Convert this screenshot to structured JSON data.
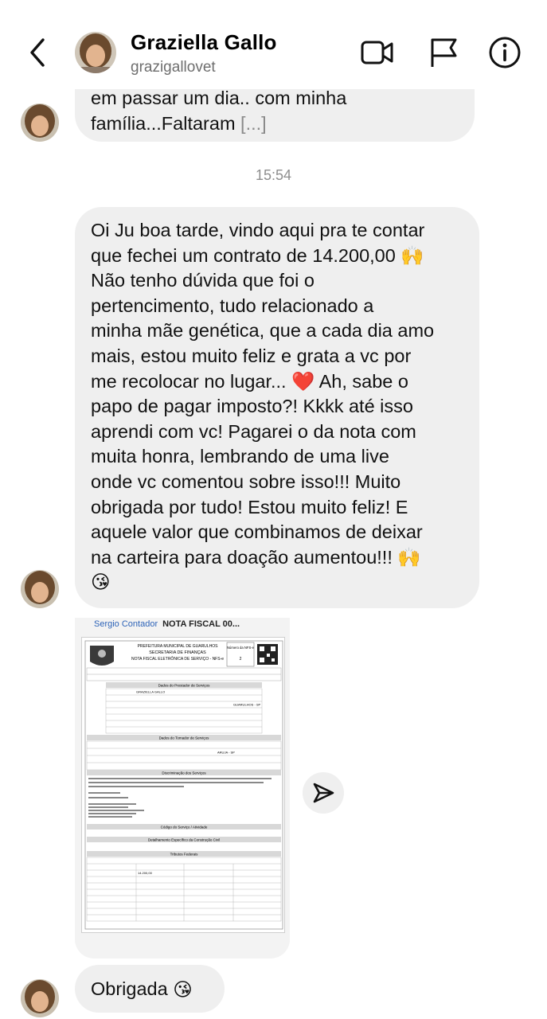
{
  "header": {
    "display_name": "Graziella Gallo",
    "username": "grazigallovet"
  },
  "messages": {
    "partial_text": "em passar um dia.. com minha\nfamília...Faltaram ",
    "partial_ellipsis": "[...]",
    "timestamp": "15:54",
    "main_text": "Oi Ju boa tarde, vindo aqui pra te contar\nque fechei um contrato de 14.200,00 🙌\nNão tenho dúvida que foi o\npertencimento, tudo relacionado a\nminha mãe genética, que a cada dia amo\nmais, estou muito feliz e grata a vc por\nme recolocar no lugar... ❤️ Ah, sabe o\npapo de pagar imposto?! Kkkk até isso\naprendi com vc! Pagarei o da nota com\nmuita honra, lembrando de uma live\nonde vc comentou sobre isso!!! Muito\nobrigada por tudo! Estou muito feliz! E\naquele valor que combinamos de deixar\nna carteira para doação aumentou!!! 🙌\n😘",
    "last_text": "Obrigada",
    "last_emoji": "😘"
  },
  "attachment": {
    "caption_left": "Sergio Contador",
    "caption_right": "NOTA FISCAL 00...",
    "doc_heading_1": "PREFEITURA MUNICIPAL DE GUARULHOS",
    "doc_heading_2": "SECRETARIA DE FINANÇAS",
    "doc_heading_3": "NOTA FISCAL ELETRÔNICA DE SERVIÇO - NFS-e",
    "doc_number_label": "Número da NFS-e",
    "doc_number": "2",
    "section_prestador": "Dados do Prestador de Serviços",
    "prestador_name": "GRAZIELLA GALLO",
    "prestador_city": "GUARULHOS - SP",
    "section_tomador": "Dados do Tomador de Serviços",
    "tomador_city": "ARUJA - SP",
    "section_discriminacao": "Discriminação dos Serviços",
    "section_codigo": "Código do Serviço / Atividade",
    "section_construcao": "Detalhamento Específico da Construção Civil",
    "section_tributos": "Tributos Federais",
    "valor_servico": "14.200,00"
  }
}
